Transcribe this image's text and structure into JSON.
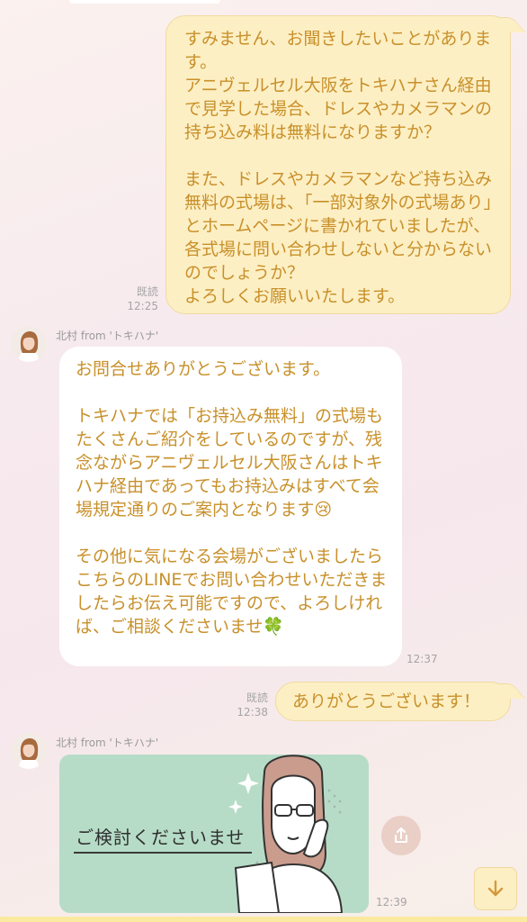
{
  "messages": {
    "outgoing_1": {
      "text": "すみません、お聞きしたいことがあります。\nアニヴェルセル大阪をトキハナさん経由で見学した場合、ドレスやカメラマンの持ち込み料は無料になりますか？\n\nまた、ドレスやカメラマンなど持ち込み無料の式場は、「一部対象外の式場あり」とホームページに書かれていましたが、各式場に問い合わせしないと分からないのでしょうか？\nよろしくお願いいたします。",
      "read": "既読",
      "time": "12:25"
    },
    "incoming_1": {
      "sender": "北村 from 'トキハナ'",
      "text": "お問合せありがとうございます。\n\nトキハナでは「お持込み無料」の式場もたくさんご紹介をしているのですが、残念ながらアニヴェルセル大阪さんはトキハナ経由であってもお持込みはすべて会場規定通りのご案内となります😢\n\nその他に気になる会場がございましたらこちらのLINEでお問い合わせいただきましたらお伝え可能ですので、よろしければ、ご相談くださいませ🍀",
      "time": "12:37"
    },
    "outgoing_2": {
      "text": "ありがとうございます！",
      "read": "既読",
      "time": "12:38"
    },
    "incoming_2": {
      "sender": "北村 from 'トキハナ'",
      "image_text": "ご検討くださいませ",
      "time": "12:39"
    }
  },
  "icons": {
    "share": "share-icon",
    "scroll_down": "arrow-down-icon",
    "avatar": "avatar"
  },
  "colors": {
    "text_accent": "#c8902a",
    "outgoing_bubble": "#fdefc4",
    "incoming_bubble": "#ffffff",
    "card_bg": "#b6dcc7"
  }
}
